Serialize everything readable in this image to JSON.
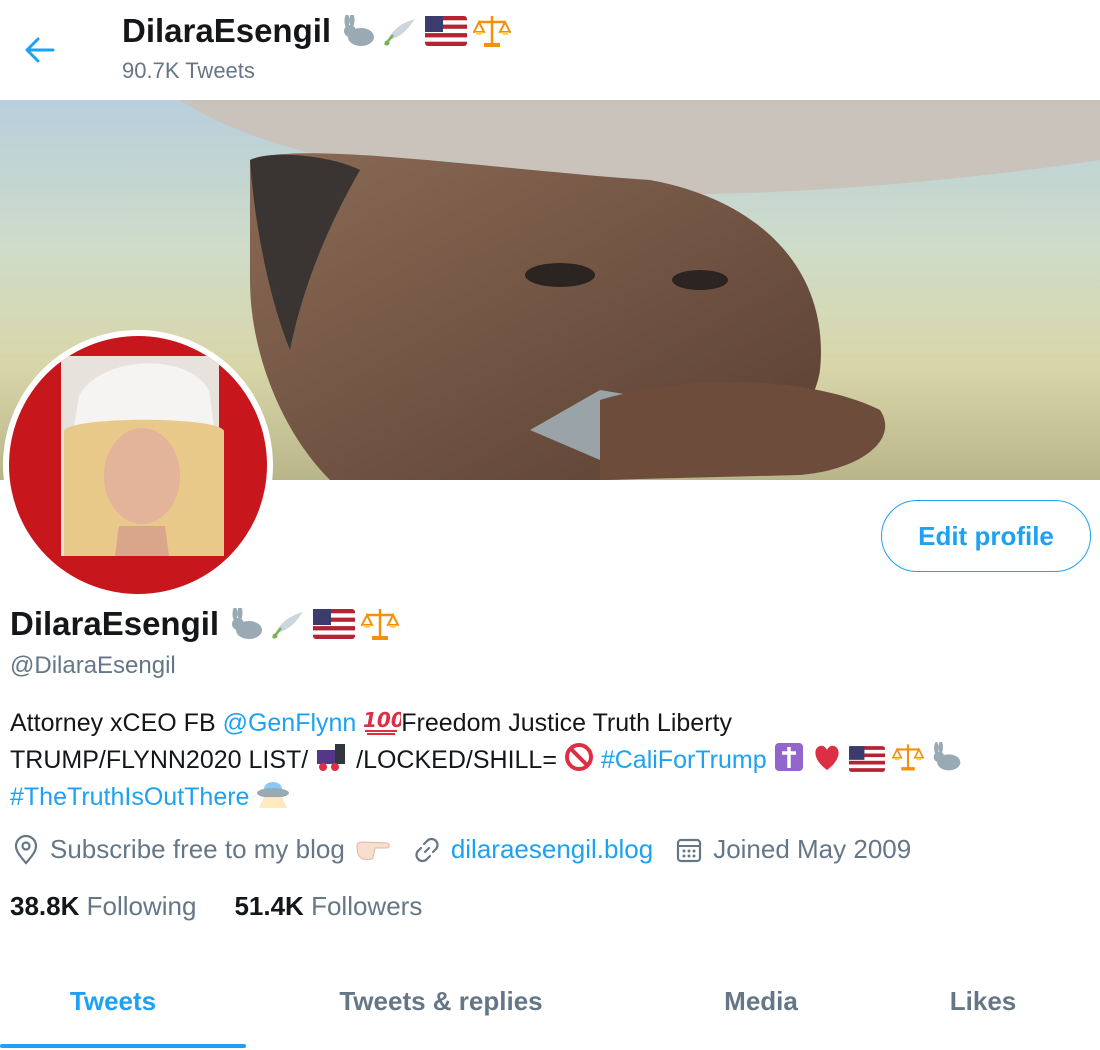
{
  "header": {
    "name": "DilaraEsengil",
    "tweet_count": "90.7K Tweets"
  },
  "profile": {
    "display_name": "DilaraEsengil",
    "handle": "@DilaraEsengil",
    "edit_label": "Edit profile",
    "bio": {
      "line1_a": "Attorney xCEO FB ",
      "mention": "@GenFlynn",
      "line1_b": "Freedom Justice Truth Liberty",
      "line2_a": "TRUMP/FLYNN2020 LIST/",
      "line2_b": "/LOCKED/SHILL=",
      "hashtag1": "#CaliForTrump",
      "hashtag2": "#TheTruthIsOutThere"
    },
    "location": "Subscribe free to my blog",
    "website": "dilaraesengil.blog",
    "joined": "Joined May 2009",
    "following_count": "38.8K",
    "following_label": "Following",
    "followers_count": "51.4K",
    "followers_label": "Followers"
  },
  "tabs": [
    "Tweets",
    "Tweets & replies",
    "Media",
    "Likes"
  ],
  "colors": {
    "accent": "#1da1f2",
    "muted": "#657786",
    "text": "#14171a"
  },
  "icons": [
    "back-arrow-icon",
    "rabbit-icon",
    "dove-icon",
    "us-flag-icon",
    "scales-icon",
    "hundred-icon",
    "train-icon",
    "no-entry-icon",
    "cross-icon",
    "heart-icon",
    "ufo-icon",
    "location-icon",
    "link-icon",
    "calendar-icon",
    "pointing-hand-icon"
  ]
}
